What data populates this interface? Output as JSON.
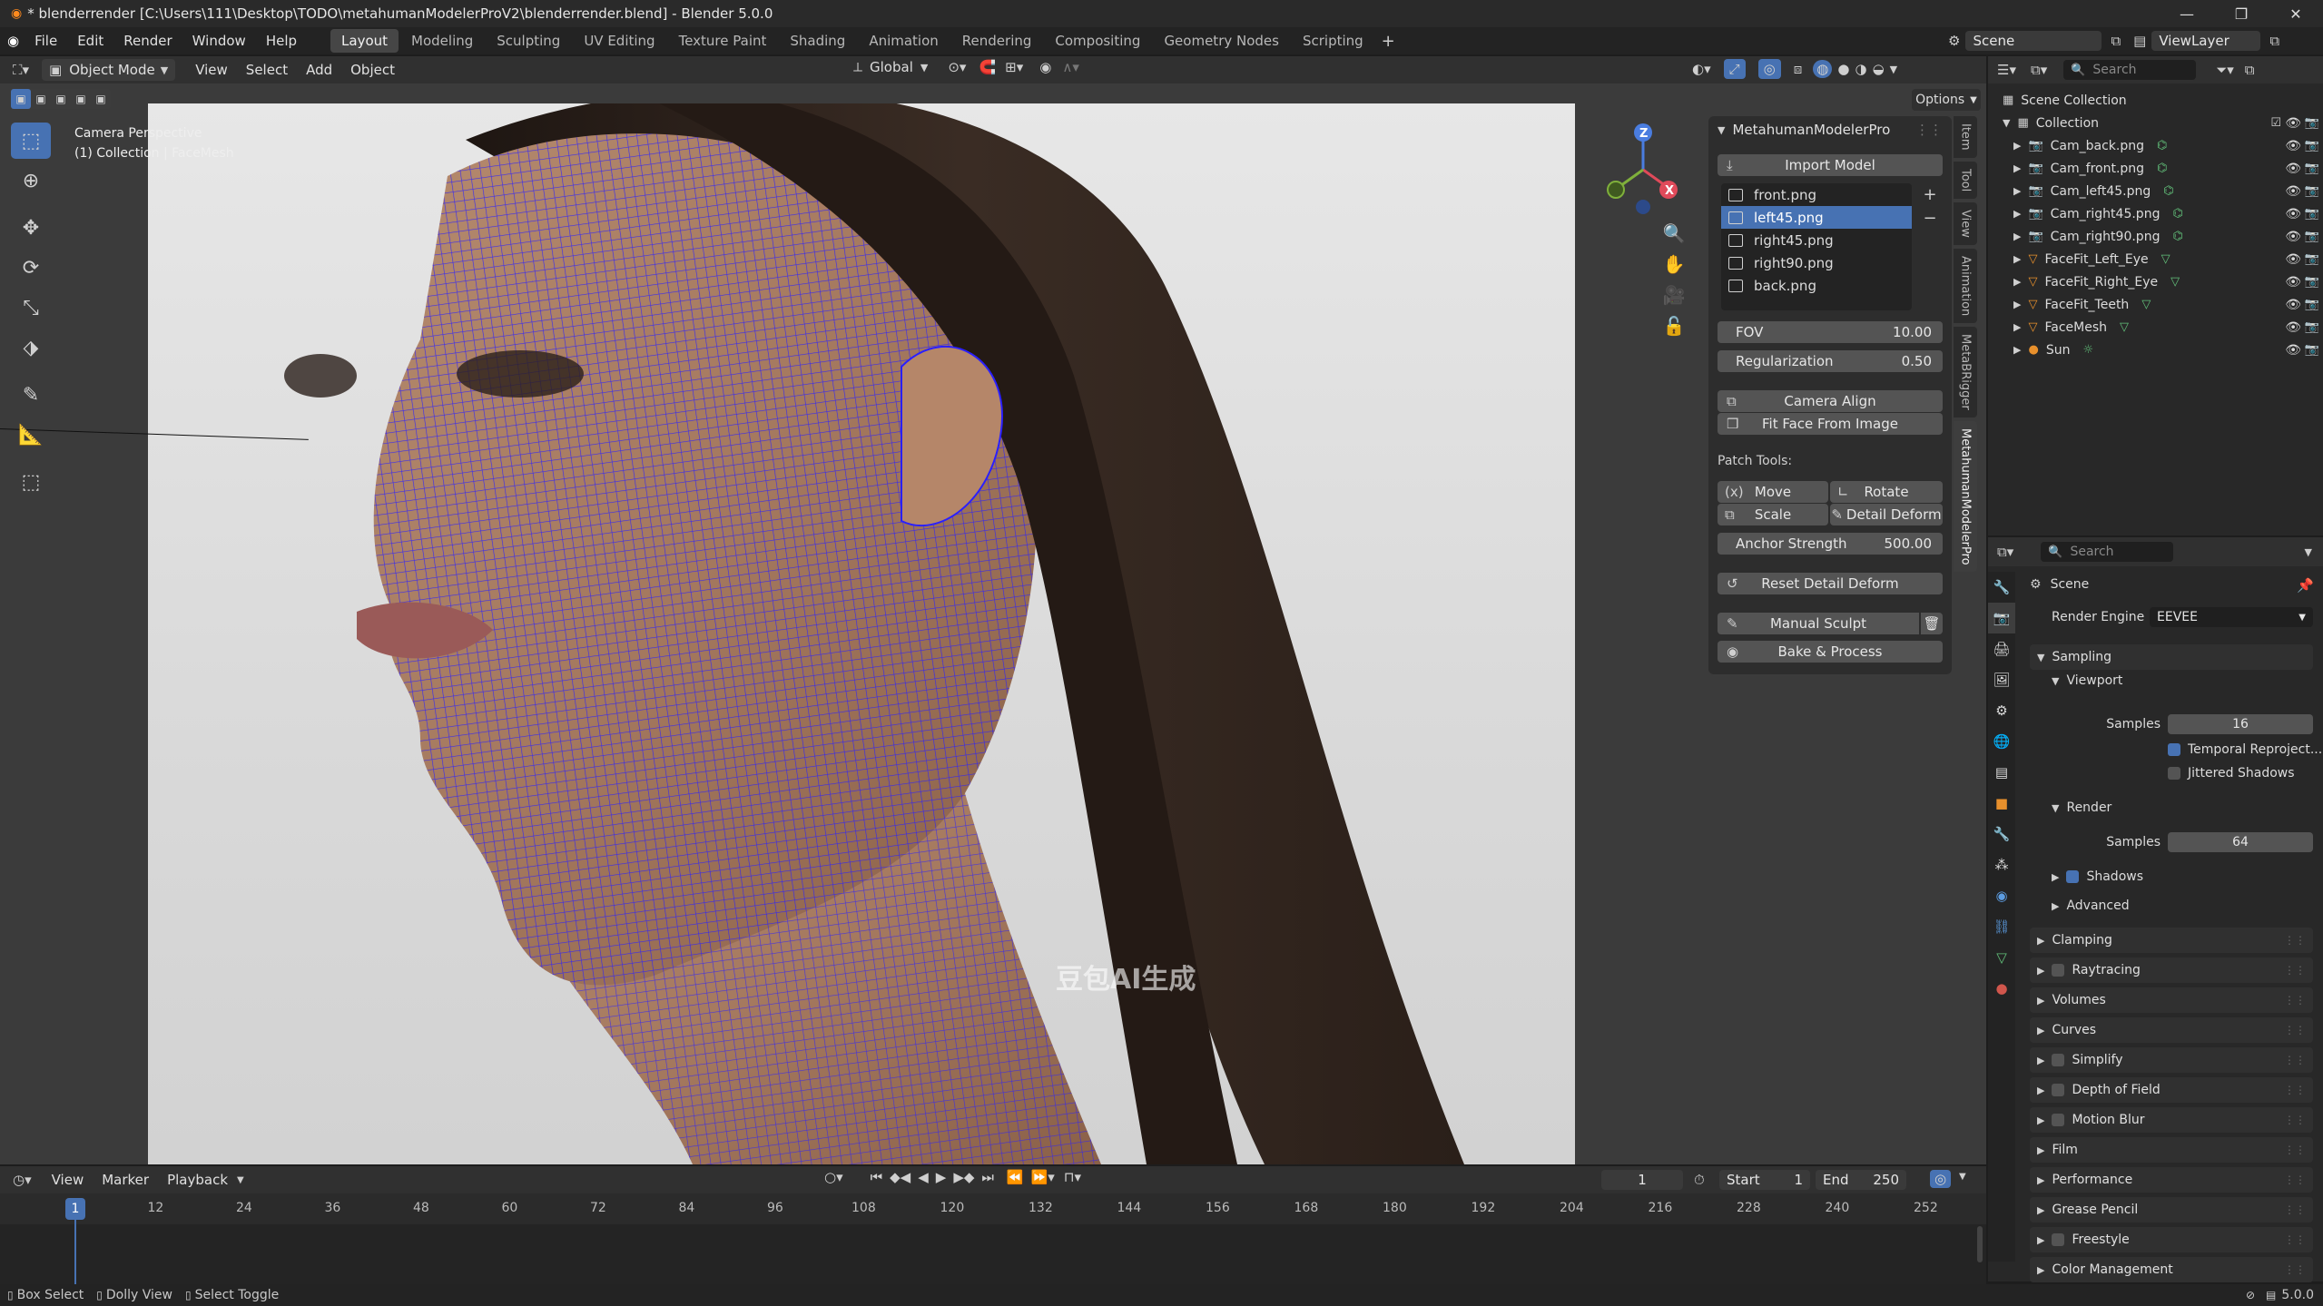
{
  "window": {
    "title": "* blenderrender [C:\\Users\\111\\Desktop\\TODO\\metahumanModelerProV2\\blenderrender.blend] - Blender 5.0.0"
  },
  "menubar": {
    "menus": [
      "File",
      "Edit",
      "Render",
      "Window",
      "Help"
    ],
    "workspaces": [
      "Layout",
      "Modeling",
      "Sculpting",
      "UV Editing",
      "Texture Paint",
      "Shading",
      "Animation",
      "Rendering",
      "Compositing",
      "Geometry Nodes",
      "Scripting"
    ],
    "active_workspace": "Layout",
    "scene": "Scene",
    "view_layer": "ViewLayer"
  },
  "viewport_header": {
    "mode": "Object Mode",
    "menus": [
      "View",
      "Select",
      "Add",
      "Object"
    ],
    "orientation": "Global",
    "options_label": "Options"
  },
  "viewport": {
    "camera_label": "Camera Perspective",
    "collection_label": "(1) Collection | FaceMesh",
    "watermark": "豆包AI生成",
    "gizmo_axes": {
      "x": "X",
      "z": "Z"
    }
  },
  "npanel": {
    "title": "MetahumanModelerPro",
    "import_label": "Import Model",
    "images": [
      {
        "name": "front.png",
        "selected": false
      },
      {
        "name": "left45.png",
        "selected": true
      },
      {
        "name": "right45.png",
        "selected": false
      },
      {
        "name": "right90.png",
        "selected": false
      },
      {
        "name": "back.png",
        "selected": false
      }
    ],
    "fov": {
      "label": "FOV",
      "value": "10.00"
    },
    "regularization": {
      "label": "Regularization",
      "value": "0.50"
    },
    "camera_align": "Camera Align",
    "fit_face": "Fit Face From Image",
    "patch_tools": "Patch Tools:",
    "move": "Move",
    "rotate": "Rotate",
    "scale": "Scale",
    "detail_deform": "Detail Deform",
    "anchor_strength": {
      "label": "Anchor Strength",
      "value": "500.00"
    },
    "reset_detail": "Reset Detail Deform",
    "manual_sculpt": "Manual Sculpt",
    "bake_process": "Bake & Process"
  },
  "vtabs": [
    "Item",
    "Tool",
    "View",
    "Animation",
    "MetaBRigger",
    "MetahumanModelerPro"
  ],
  "outliner": {
    "search_placeholder": "Search",
    "root": "Scene Collection",
    "collection": "Collection",
    "items": [
      {
        "name": "Cam_back.png",
        "type": "camera"
      },
      {
        "name": "Cam_front.png",
        "type": "camera"
      },
      {
        "name": "Cam_left45.png",
        "type": "camera"
      },
      {
        "name": "Cam_right45.png",
        "type": "camera"
      },
      {
        "name": "Cam_right90.png",
        "type": "camera"
      },
      {
        "name": "FaceFit_Left_Eye",
        "type": "mesh"
      },
      {
        "name": "FaceFit_Right_Eye",
        "type": "mesh"
      },
      {
        "name": "FaceFit_Teeth",
        "type": "mesh"
      },
      {
        "name": "FaceMesh",
        "type": "mesh"
      },
      {
        "name": "Sun",
        "type": "light"
      }
    ]
  },
  "properties": {
    "search_placeholder": "Search",
    "context": "Scene",
    "render_engine_label": "Render Engine",
    "render_engine": "EEVEE",
    "sampling": "Sampling",
    "viewport": "Viewport",
    "viewport_samples_label": "Samples",
    "viewport_samples": "16",
    "temporal": "Temporal Reproject...",
    "jittered": "Jittered Shadows",
    "render": "Render",
    "render_samples_label": "Samples",
    "render_samples": "64",
    "shadows": "Shadows",
    "advanced": "Advanced",
    "sections": [
      "Clamping",
      "Raytracing",
      "Volumes",
      "Curves",
      "Simplify",
      "Depth of Field",
      "Motion Blur",
      "Film",
      "Performance",
      "Grease Pencil",
      "Freestyle",
      "Color Management"
    ]
  },
  "timeline": {
    "menus": [
      "View",
      "Marker",
      "Playback"
    ],
    "current_frame": "1",
    "start_label": "Start",
    "start": "1",
    "end_label": "End",
    "end": "250",
    "ticks": [
      "12",
      "24",
      "36",
      "48",
      "60",
      "72",
      "84",
      "96",
      "108",
      "120",
      "132",
      "144",
      "156",
      "168",
      "180",
      "192",
      "204",
      "216",
      "228",
      "240",
      "252"
    ]
  },
  "statusbar": {
    "box_select": "Box Select",
    "dolly_view": "Dolly View",
    "select_toggle": "Select Toggle",
    "version": "5.0.0"
  },
  "colors": {
    "accent": "#4772b3",
    "wire": "#2a1fff"
  }
}
